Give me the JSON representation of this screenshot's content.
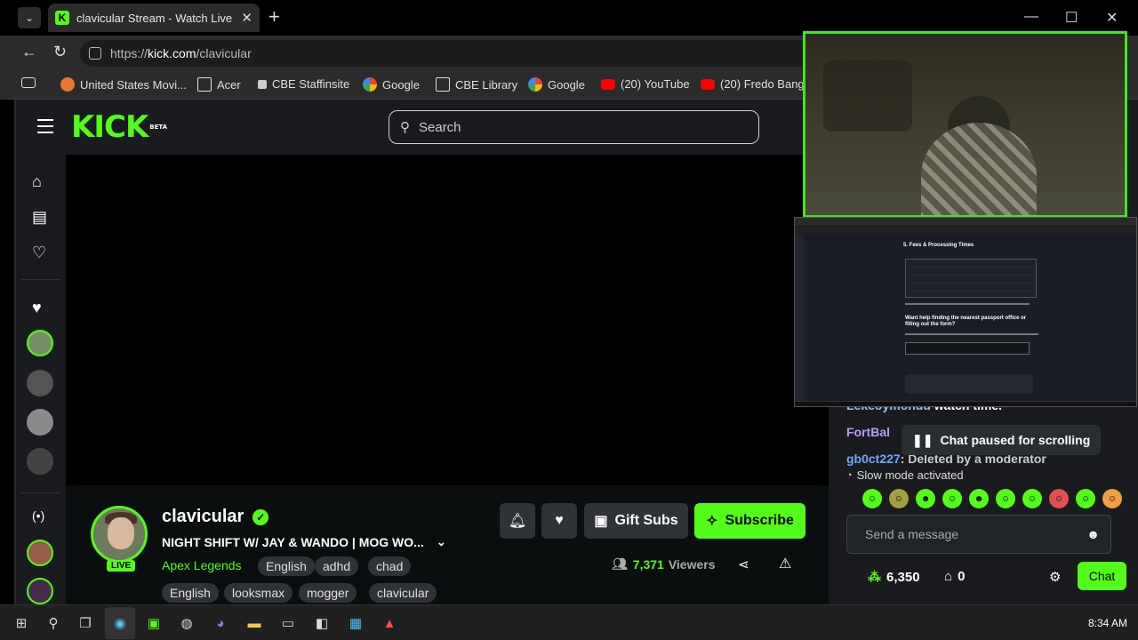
{
  "browser": {
    "tab_title": "clavicular Stream - Watch Live on Kick",
    "url_scheme": "https://",
    "url_domain": "kick.com",
    "url_path": "/clavicular",
    "bookmarks": [
      {
        "label": "United States Movi...",
        "icon": "film-icon",
        "color": "#e8762b"
      },
      {
        "label": "Acer",
        "icon": "folder-icon",
        "color": "#e0e0e0"
      },
      {
        "label": "CBE Staffinsite",
        "icon": "page-icon",
        "color": "#cccccc"
      },
      {
        "label": "Google",
        "icon": "google-icon",
        "color": "#4285f4"
      },
      {
        "label": "CBE Library",
        "icon": "library-icon",
        "color": "#dddddd"
      },
      {
        "label": "Google",
        "icon": "google-icon",
        "color": "#4285f4"
      },
      {
        "label": "(20) YouTube",
        "icon": "youtube-icon",
        "color": "#ff0000"
      },
      {
        "label": "(20) Fredo Bang",
        "icon": "youtube-icon",
        "color": "#ff0000"
      }
    ]
  },
  "kick": {
    "logo_text": "KICK",
    "logo_badge": "BETA",
    "search_placeholder": "Search",
    "accent": "#53fc18"
  },
  "channel": {
    "name": "clavicular",
    "live_badge": "LIVE",
    "stream_title": "NIGHT SHIFT W/ JAY & WANDO | MOG WO...",
    "category": "Apex Legends",
    "tags_row1": [
      "English",
      "adhd",
      "chad"
    ],
    "tags_row2": [
      "English",
      "looksmax",
      "mogger",
      "clavicular"
    ],
    "gift_label": "Gift Subs",
    "subscribe_label": "Subscribe",
    "viewers_count": "7,371",
    "viewers_label": "Viewers"
  },
  "chat": {
    "line1_user": "Lekeoymondd",
    "line1_text": "watch time.",
    "line2_user": "FortBal",
    "line3_user": "gb0ct227",
    "line3_text": "Deleted by a moderator",
    "paused_label": "Chat paused for scrolling",
    "slow_mode": "Slow mode activated",
    "message_placeholder": "Send a message",
    "points": "6,350",
    "store_count": "0",
    "chat_button": "Chat"
  },
  "overlay_screenshot": {
    "heading": "5. Fees & Processing Times",
    "question": "Want help finding the nearest passport office or filling out the form?"
  },
  "taskbar": {
    "time": "8:34 AM"
  }
}
